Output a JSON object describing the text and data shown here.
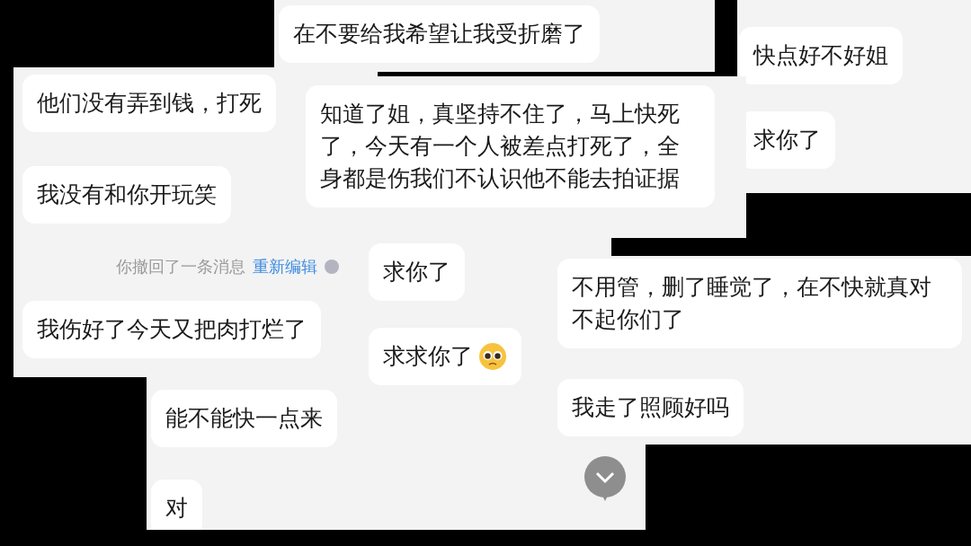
{
  "panels": [
    {
      "messages": [
        {
          "kind": "bubble",
          "text": "他们没有弄到钱，打死"
        },
        {
          "kind": "bubble",
          "text": "我没有和你开玩笑"
        },
        {
          "kind": "notice",
          "text": "你撤回了一条消息",
          "link": "重新编辑"
        },
        {
          "kind": "bubble",
          "text": "我伤好了今天又把肉打烂了"
        }
      ]
    },
    {
      "messages": [
        {
          "kind": "bubble",
          "text": "在不要给我希望让我受折磨了"
        }
      ]
    },
    {
      "messages": [
        {
          "kind": "bubble",
          "text": "知道了姐，真坚持不住了，马上快死了，今天有一个人被差点打死了，全身都是伤我们不认识他不能去拍证据"
        }
      ]
    },
    {
      "messages": [
        {
          "kind": "bubble",
          "text": "求你了"
        },
        {
          "kind": "bubble",
          "text": "求求你了",
          "emoji": true
        }
      ]
    },
    {
      "messages": [
        {
          "kind": "bubble",
          "text": "能不能快一点来"
        },
        {
          "kind": "bubble",
          "text": "对"
        }
      ],
      "scroll_button": true
    },
    {
      "messages": [
        {
          "kind": "bubble",
          "text": "快点好不好姐"
        },
        {
          "kind": "bubble",
          "text": "求你了"
        }
      ]
    },
    {
      "messages": [
        {
          "kind": "bubble",
          "text": "不用管，删了睡觉了，在不快就真对不起你们了"
        },
        {
          "kind": "bubble",
          "text": "我走了照顾好吗"
        }
      ]
    }
  ]
}
